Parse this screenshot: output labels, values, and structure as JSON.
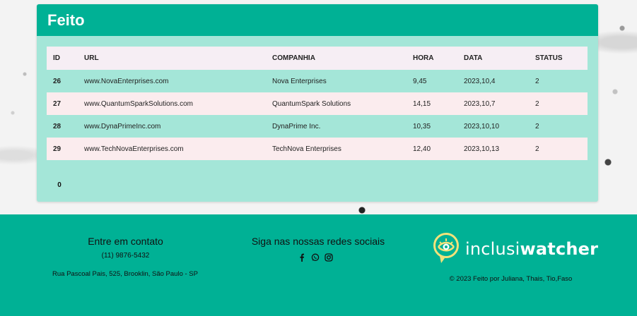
{
  "card": {
    "title": "Feito"
  },
  "table": {
    "headers": [
      "ID",
      "URL",
      "COMPANHIA",
      "HORA",
      "DATA",
      "STATUS"
    ],
    "rows": [
      {
        "id": "26",
        "url": "www.NovaEnterprises.com",
        "company": "Nova Enterprises",
        "hour": "9,45",
        "date": "2023,10,4",
        "status": "2"
      },
      {
        "id": "27",
        "url": "www.QuantumSparkSolutions.com",
        "company": "QuantumSpark Solutions",
        "hour": "14,15",
        "date": "2023,10,7",
        "status": "2"
      },
      {
        "id": "28",
        "url": "www.DynaPrimeInc.com",
        "company": "DynaPrime Inc.",
        "hour": "10,35",
        "date": "2023,10,10",
        "status": "2"
      },
      {
        "id": "29",
        "url": "www.TechNovaEnterprises.com",
        "company": "TechNova Enterprises",
        "hour": "12,40",
        "date": "2023,10,13",
        "status": "2"
      }
    ]
  },
  "pager": {
    "current": "0"
  },
  "footer": {
    "contact_title": "Entre em contato",
    "phone": "(11) 9876-5432",
    "address": "Rua Pascoal Pais, 525, Brooklin, São Paulo - SP",
    "social_title": "Siga nas nossas redes sociais",
    "social_icons": [
      "facebook-icon",
      "whatsapp-icon",
      "instagram-icon"
    ],
    "logo_light": "inclusi",
    "logo_bold": "watcher",
    "copyright": "© 2023 Feito por Juliana, Thais, Tio,Faso"
  },
  "colors": {
    "brand": "#00b195",
    "card_body": "#a4e6d8",
    "row_alt": "#fbecee",
    "header_row": "#f6eef4",
    "logo_yellow": "#f3e27a"
  }
}
